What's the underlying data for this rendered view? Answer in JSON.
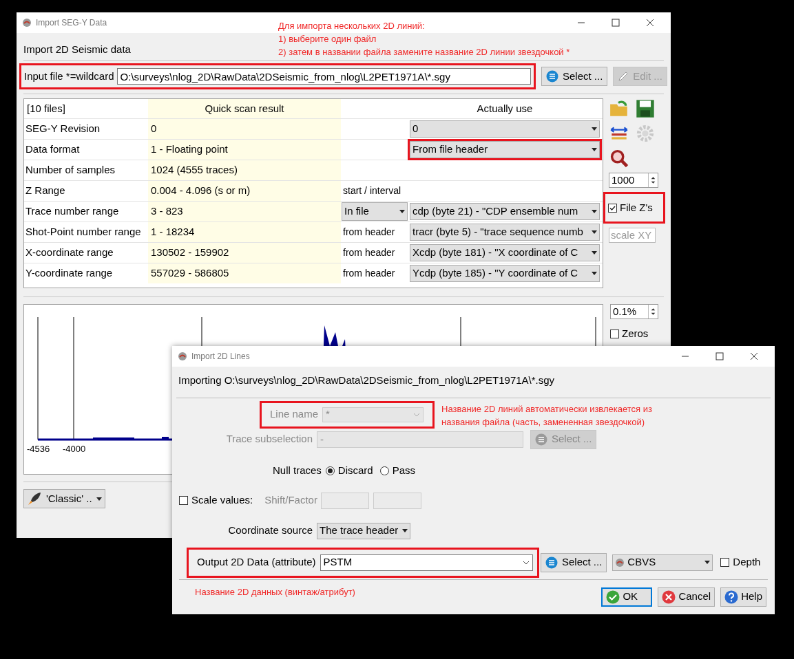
{
  "main_window": {
    "title": "Import SEG-Y Data",
    "heading": "Import 2D Seismic data",
    "annotation": [
      "Для импорта нескольких 2D линий:",
      "1) выберите один файл",
      "2) затем в названии файла замените название 2D линии звездочкой *"
    ],
    "input_file": {
      "label": "Input file *=wildcard",
      "value": "O:\\surveys\\nlog_2D\\RawData\\2DSeismic_from_nlog\\L2PET1971A\\*.sgy",
      "highlighted": true
    },
    "select_button": {
      "label": "Select ...",
      "disabled": false
    },
    "edit_button": {
      "label": "Edit ...",
      "disabled": true
    },
    "table": {
      "corner": "[10 files]",
      "scan_header": "Quick scan result",
      "use_header": "Actually use",
      "rows": [
        {
          "label": "SEG-Y Revision",
          "scan": "0",
          "use": {
            "value": "0",
            "highlighted": false
          }
        },
        {
          "label": "Data format",
          "scan": "1 - Floating point",
          "use": {
            "value": "From file header",
            "highlighted": true
          }
        },
        {
          "label": "Number of samples",
          "scan": "1024 (4555 traces)"
        },
        {
          "label": "Z Range",
          "scan": "0.004 - 4.096 (s or m)",
          "source": {
            "kind": "text",
            "value": "start / interval"
          }
        },
        {
          "label": "Trace number range",
          "scan": "3 - 823",
          "source": {
            "kind": "dropdown",
            "value": "In file"
          },
          "use": {
            "value": "cdp (byte 21) - \"CDP ensemble num",
            "highlighted": false
          }
        },
        {
          "label": "Shot-Point number range",
          "scan": "1 - 18234",
          "source": {
            "kind": "text",
            "value": "from header"
          },
          "use": {
            "value": "tracr (byte 5) - \"trace sequence numb",
            "highlighted": false
          }
        },
        {
          "label": "X-coordinate range",
          "scan": "130502 - 159902",
          "source": {
            "kind": "text",
            "value": "from header"
          },
          "use": {
            "value": "Xcdp (byte 181) - \"X coordinate of C",
            "highlighted": false
          }
        },
        {
          "label": "Y-coordinate range",
          "scan": "557029 - 586805",
          "source": {
            "kind": "text",
            "value": "from header"
          },
          "use": {
            "value": "Ycdp (byte 185) - \"Y coordinate of C",
            "highlighted": false
          }
        }
      ]
    },
    "sample_spin": "1000",
    "file_zs": {
      "label": "File Z's",
      "checked": true,
      "highlighted": true
    },
    "scale_xy": {
      "placeholder": "scale XY"
    },
    "histogram": {
      "tick_labels": [
        "-4536",
        "-4000"
      ]
    },
    "clip_spin": "0.1%",
    "zeros": {
      "label": "Zeros",
      "checked": false
    },
    "classic_button": "'Classic' .."
  },
  "lines_window": {
    "title": "Import 2D Lines",
    "importing": "Importing O:\\surveys\\nlog_2D\\RawData\\2DSeismic_from_nlog\\L2PET1971A\\*.sgy",
    "line_name": {
      "label": "Line name",
      "value": "*",
      "disabled": true,
      "highlighted": true
    },
    "line_note": [
      "Название 2D линий автоматически извлекается из",
      "названия файла (часть, замененная звездочкой)"
    ],
    "trace_subselection": {
      "label": "Trace subselection",
      "value": "-",
      "disabled": true
    },
    "subsel_button": {
      "label": "Select ...",
      "disabled": true
    },
    "null_traces": {
      "label": "Null traces",
      "options": [
        {
          "label": "Discard",
          "selected": true
        },
        {
          "label": "Pass",
          "selected": false
        }
      ]
    },
    "scale_values": {
      "label": "Scale values:",
      "checked": false
    },
    "shift_factor": "Shift/Factor",
    "coordinate_source": {
      "label": "Coordinate source",
      "value": "The trace header"
    },
    "output": {
      "label": "Output 2D Data (attribute)",
      "value": "PSTM",
      "highlighted": true
    },
    "output_select": {
      "label": "Select ...",
      "disabled": false
    },
    "format": "CBVS",
    "depth": {
      "label": "Depth",
      "checked": false
    },
    "output_note": "Название 2D данных (винтаж/атрибут)",
    "buttons": [
      {
        "kind": "ok",
        "label": "OK"
      },
      {
        "kind": "cancel",
        "label": "Cancel"
      },
      {
        "kind": "help",
        "label": "Help"
      }
    ]
  }
}
